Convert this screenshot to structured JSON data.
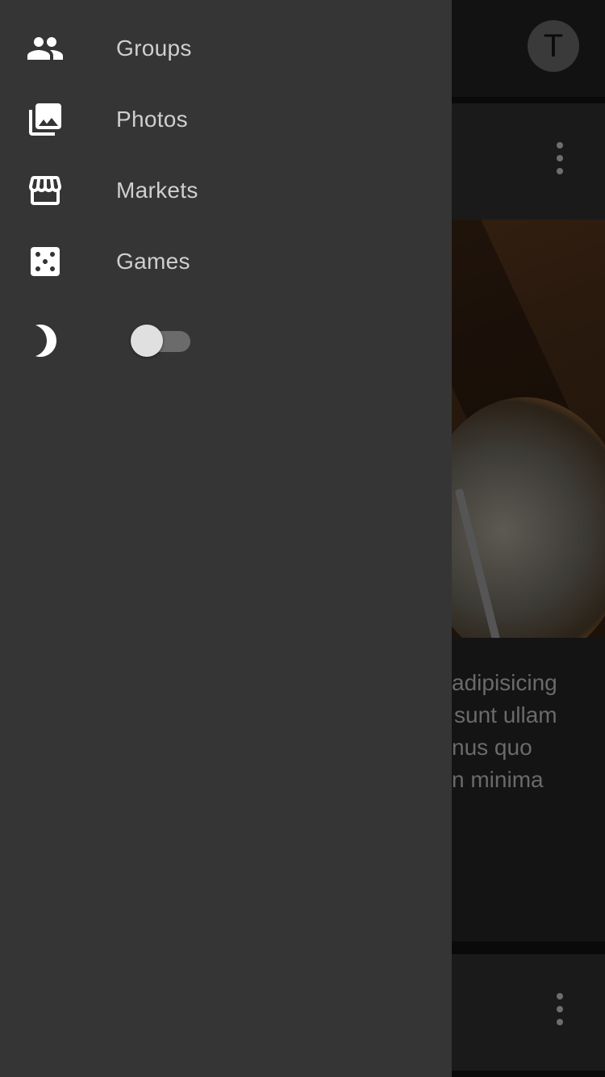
{
  "drawer": {
    "items": [
      {
        "label": "Groups",
        "icon": "groups-icon"
      },
      {
        "label": "Photos",
        "icon": "photos-icon"
      },
      {
        "label": "Markets",
        "icon": "storefront-icon"
      },
      {
        "label": "Games",
        "icon": "dice-icon"
      }
    ],
    "dark_mode": {
      "icon": "moon-icon",
      "enabled": false
    }
  },
  "background": {
    "avatar_initial": "T",
    "card_text_lines": [
      "adipisicing",
      "sunt ullam",
      "nus quo",
      "n minima"
    ]
  },
  "colors": {
    "drawer_bg": "#353535",
    "label_text": "#cfcfcf",
    "icon": "#ffffff"
  }
}
